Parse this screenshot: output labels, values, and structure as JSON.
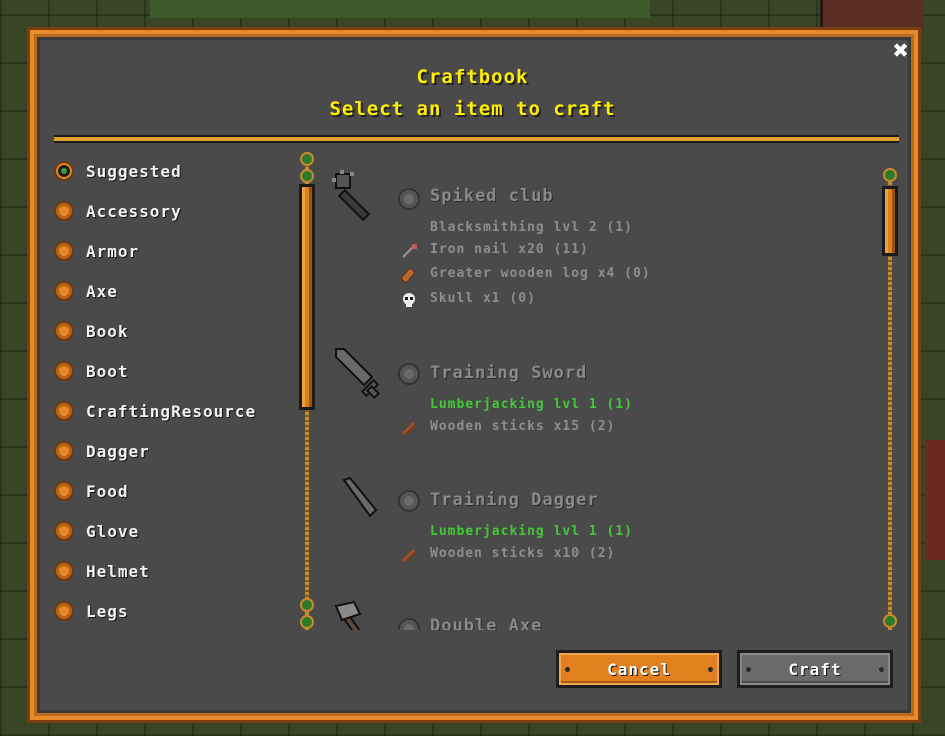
{
  "header": {
    "title": "Craftbook",
    "subtitle": "Select an item to craft",
    "close_label": "✖"
  },
  "categories": [
    {
      "label": "Suggested",
      "selected": true
    },
    {
      "label": "Accessory",
      "selected": false
    },
    {
      "label": "Armor",
      "selected": false
    },
    {
      "label": "Axe",
      "selected": false
    },
    {
      "label": "Book",
      "selected": false
    },
    {
      "label": "Boot",
      "selected": false
    },
    {
      "label": "CraftingResource",
      "selected": false
    },
    {
      "label": "Dagger",
      "selected": false
    },
    {
      "label": "Food",
      "selected": false
    },
    {
      "label": "Glove",
      "selected": false
    },
    {
      "label": "Helmet",
      "selected": false
    },
    {
      "label": "Legs",
      "selected": false
    }
  ],
  "recipes": [
    {
      "name": "Spiked club",
      "icon": "spiked-club-icon",
      "requirement": "Blacksmithing lvl 2 (1)",
      "requirement_met": false,
      "ingredients": [
        {
          "label": "Iron nail x20 (11)",
          "icon": "iron-nail-icon"
        },
        {
          "label": "Greater wooden log x4 (0)",
          "icon": "wooden-log-icon"
        },
        {
          "label": "Skull x1 (0)",
          "icon": "skull-icon"
        }
      ]
    },
    {
      "name": "Training Sword",
      "icon": "training-sword-icon",
      "requirement": "Lumberjacking lvl 1 (1)",
      "requirement_met": true,
      "ingredients": [
        {
          "label": "Wooden sticks x15 (2)",
          "icon": "wooden-sticks-icon"
        }
      ]
    },
    {
      "name": "Training Dagger",
      "icon": "training-dagger-icon",
      "requirement": "Lumberjacking lvl 1 (1)",
      "requirement_met": true,
      "ingredients": [
        {
          "label": "Wooden sticks x10 (2)",
          "icon": "wooden-sticks-icon"
        }
      ]
    },
    {
      "name": "Double Axe",
      "icon": "double-axe-icon"
    }
  ],
  "buttons": {
    "cancel": "Cancel",
    "craft": "Craft"
  },
  "colors": {
    "title": "#ffee00",
    "frame": "#e88a2a",
    "panel": "#4a4a4a",
    "requirement_met": "#44c83a",
    "requirement_unmet": "#8e8e8e"
  }
}
